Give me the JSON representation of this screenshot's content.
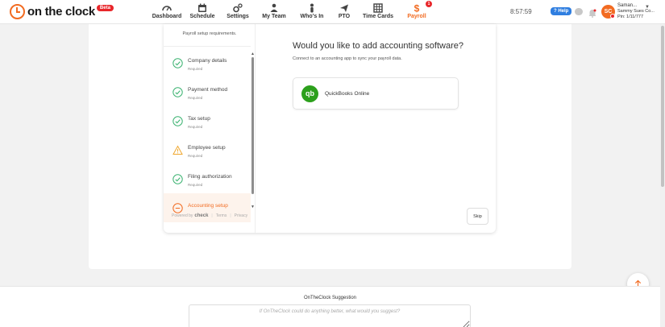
{
  "app": {
    "logo_text": "on the clock",
    "beta_label": "Beta"
  },
  "nav": [
    {
      "label": "Dashboard",
      "icon": "gauge-icon",
      "active": false
    },
    {
      "label": "Schedule",
      "icon": "calendar-icon",
      "active": false
    },
    {
      "label": "Settings",
      "icon": "gears-icon",
      "active": false
    },
    {
      "label": "My Team",
      "icon": "team-icon",
      "active": false
    },
    {
      "label": "Who's In",
      "icon": "person-icon",
      "active": false
    },
    {
      "label": "PTO",
      "icon": "plane-icon",
      "active": false
    },
    {
      "label": "Time Cards",
      "icon": "grid-icon",
      "active": false
    },
    {
      "label": "Payroll",
      "icon": "dollar-icon",
      "active": true,
      "badge": "1"
    }
  ],
  "header": {
    "time": "8:57:59",
    "help_label": "? Help",
    "avatar_initials": "SC",
    "user_name": "Saman...",
    "company": "Sammy Sues Co...",
    "pin": "Pin: 1/11/777"
  },
  "sidebar": {
    "header": "Payroll setup requirements.",
    "steps": [
      {
        "label": "Company details",
        "sub": "Required",
        "status": "done"
      },
      {
        "label": "Payment method",
        "sub": "Required",
        "status": "done"
      },
      {
        "label": "Tax setup",
        "sub": "Required",
        "status": "done"
      },
      {
        "label": "Employee setup",
        "sub": "Required",
        "status": "warning"
      },
      {
        "label": "Filing authorization",
        "sub": "Required",
        "status": "done"
      },
      {
        "label": "Accounting setup",
        "sub": "",
        "status": "active"
      }
    ],
    "powered_by": "Powered by",
    "powered_brand": "check",
    "terms": "Terms",
    "privacy": "Privacy"
  },
  "content": {
    "title": "Would you like to add accounting software?",
    "subtitle": "Connect to an accounting app to sync your payroll data.",
    "option_label": "QuickBooks Online",
    "option_logo_text": "qb",
    "skip_label": "Skip"
  },
  "footer": {
    "suggestion_title": "OnTheClock Suggestion",
    "suggestion_placeholder": "If OnTheClock could do anything better, what would you suggest?"
  },
  "colors": {
    "brand_orange": "#f26b21",
    "success_green": "#2ca01c",
    "help_blue": "#2f7ee0",
    "badge_red": "#e8262a"
  }
}
